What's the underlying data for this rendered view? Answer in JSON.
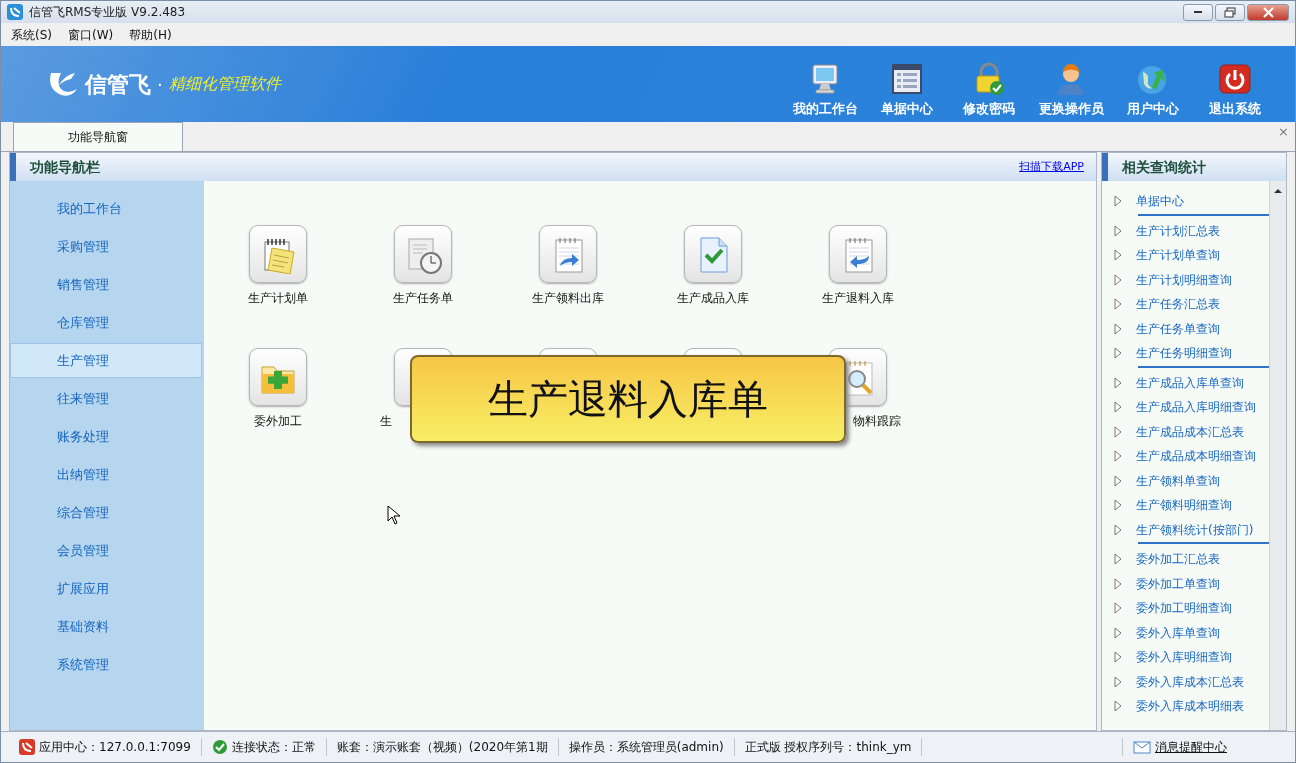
{
  "window": {
    "title": "信管飞RMS专业版 V9.2.483"
  },
  "menu": [
    "系统(S)",
    "窗口(W)",
    "帮助(H)"
  ],
  "banner": {
    "brand": "信管飞",
    "separator": "·",
    "tagline": "精细化管理软件"
  },
  "toolbar": [
    {
      "kind": "monitor",
      "label": "我的工作台"
    },
    {
      "kind": "list",
      "label": "单据中心"
    },
    {
      "kind": "lock",
      "label": "修改密码"
    },
    {
      "kind": "user",
      "label": "更换操作员"
    },
    {
      "kind": "globe",
      "label": "用户中心"
    },
    {
      "kind": "power",
      "label": "退出系统"
    }
  ],
  "tabs": [
    {
      "label": "功能导航窗",
      "selected": true
    }
  ],
  "tab_close": "×",
  "nav_panel": {
    "title": "功能导航栏",
    "link": "扫描下载APP",
    "items": [
      {
        "label": "我的工作台",
        "selected": false
      },
      {
        "label": "采购管理",
        "selected": false
      },
      {
        "label": "销售管理",
        "selected": false
      },
      {
        "label": "仓库管理",
        "selected": false
      },
      {
        "label": "生产管理",
        "selected": true
      },
      {
        "label": "往来管理",
        "selected": false
      },
      {
        "label": "账务处理",
        "selected": false
      },
      {
        "label": "出纳管理",
        "selected": false
      },
      {
        "label": "综合管理",
        "selected": false
      },
      {
        "label": "会员管理",
        "selected": false
      },
      {
        "label": "扩展应用",
        "selected": false
      },
      {
        "label": "基础资料",
        "selected": false
      },
      {
        "label": "系统管理",
        "selected": false
      }
    ]
  },
  "functions": [
    {
      "kind": "notepad",
      "label": "生产计划单"
    },
    {
      "kind": "clock",
      "label": "生产任务单"
    },
    {
      "kind": "doc-out",
      "label": "生产领料出库"
    },
    {
      "kind": "doc-check",
      "label": "生产成品入库"
    },
    {
      "kind": "doc-in",
      "label": "生产退料入库"
    },
    {
      "kind": "folder-add",
      "label": "委外加工"
    },
    {
      "kind": "hidden",
      "label": "生"
    },
    {
      "kind": "hidden"
    },
    {
      "kind": "hidden"
    },
    {
      "kind": "magnifier",
      "label": "物料跟踪"
    }
  ],
  "tooltip": "生产退料入库单",
  "query_panel": {
    "title": "相关查询统计",
    "groups": [
      [
        "单据中心"
      ],
      [
        "生产计划汇总表",
        "生产计划单查询",
        "生产计划明细查询",
        "生产任务汇总表",
        "生产任务单查询",
        "生产任务明细查询"
      ],
      [
        "生产成品入库单查询",
        "生产成品入库明细查询",
        "生产成品成本汇总表",
        "生产成品成本明细查询",
        "生产领料单查询",
        "生产领料明细查询",
        "生产领料统计(按部门)"
      ],
      [
        "委外加工汇总表",
        "委外加工单查询",
        "委外加工明细查询",
        "委外入库单查询",
        "委外入库明细查询",
        "委外入库成本汇总表",
        "委外入库成本明细表"
      ]
    ]
  },
  "status_bar": [
    {
      "kind": "app",
      "text": "应用中心：127.0.0.1:7099"
    },
    {
      "kind": "ok",
      "text": "连接状态：正常"
    },
    {
      "kind": "text",
      "text": "账套：演示账套（视频）(2020年第1期"
    },
    {
      "kind": "text",
      "text": "操作员：系统管理员(admin)"
    },
    {
      "kind": "text",
      "text": "正式版 授权序列号：think_ym"
    },
    {
      "kind": "message",
      "text": "消息提醒中心"
    }
  ]
}
